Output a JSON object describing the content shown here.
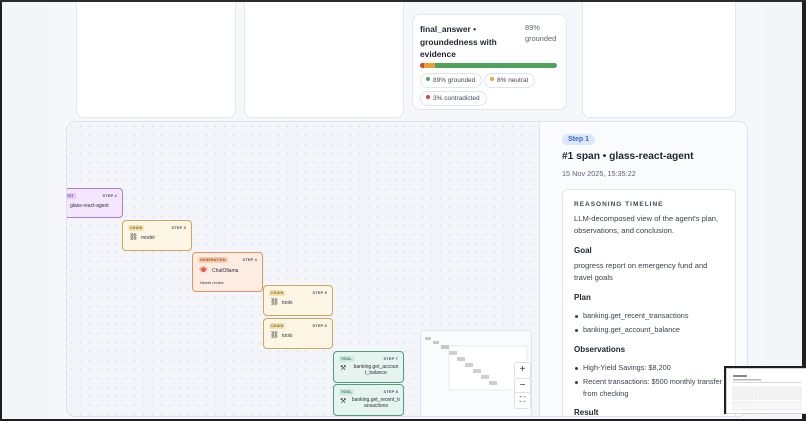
{
  "groundedness": {
    "title": "final_answer • groundedness with evidence",
    "percent": "89%",
    "percent_label": "grounded",
    "bar": {
      "grounded": 0.89,
      "neutral": 0.08,
      "contradicted": 0.03
    },
    "chips": [
      {
        "label": "89% grounded",
        "color": "#4fa35a"
      },
      {
        "label": "8% neutral",
        "color": "#f0a030"
      },
      {
        "label": "3% contradicted",
        "color": "#d9453b"
      }
    ]
  },
  "graph": {
    "nodes": [
      {
        "tag": "",
        "step": "STEP 2",
        "name": "glass-react-agent"
      },
      {
        "tag": "CHAIN",
        "step": "STEP 3",
        "name": "model"
      },
      {
        "tag": "GENERATION",
        "step": "STEP 4",
        "name": "ChatOllama",
        "note": "Needs review"
      },
      {
        "tag": "CHAIN",
        "step": "STEP 5",
        "name": "tools"
      },
      {
        "tag": "CHAIN",
        "step": "STEP 6",
        "name": "tools"
      },
      {
        "tag": "TOOL",
        "step": "STEP 7",
        "name": "banking.get_account_balance"
      },
      {
        "tag": "TOOL",
        "step": "STEP 8",
        "name": "banking.get_recent_transactions"
      }
    ],
    "controls": {
      "zoom_in": "+",
      "zoom_out": "−",
      "fit": "⛶"
    }
  },
  "detail": {
    "badge": "Step 1",
    "title": "#1 span • glass-react-agent",
    "date": "15 Nov 2025, 15:35:22",
    "timeline": {
      "heading": "REASONING TIMELINE",
      "intro": "LLM-decomposed view of the agent's plan, observations, and conclusion.",
      "goal_heading": "Goal",
      "goal": "progress report on emergency fund and travel goals",
      "plan_heading": "Plan",
      "plan": [
        "banking.get_recent_transactions",
        "banking.get_account_balance"
      ],
      "obs_heading": "Observations",
      "observations": [
        "High-Yield Savings: $8,200",
        "Recent transactions: $500 monthly transfer from checking"
      ],
      "result_heading": "Result"
    }
  }
}
